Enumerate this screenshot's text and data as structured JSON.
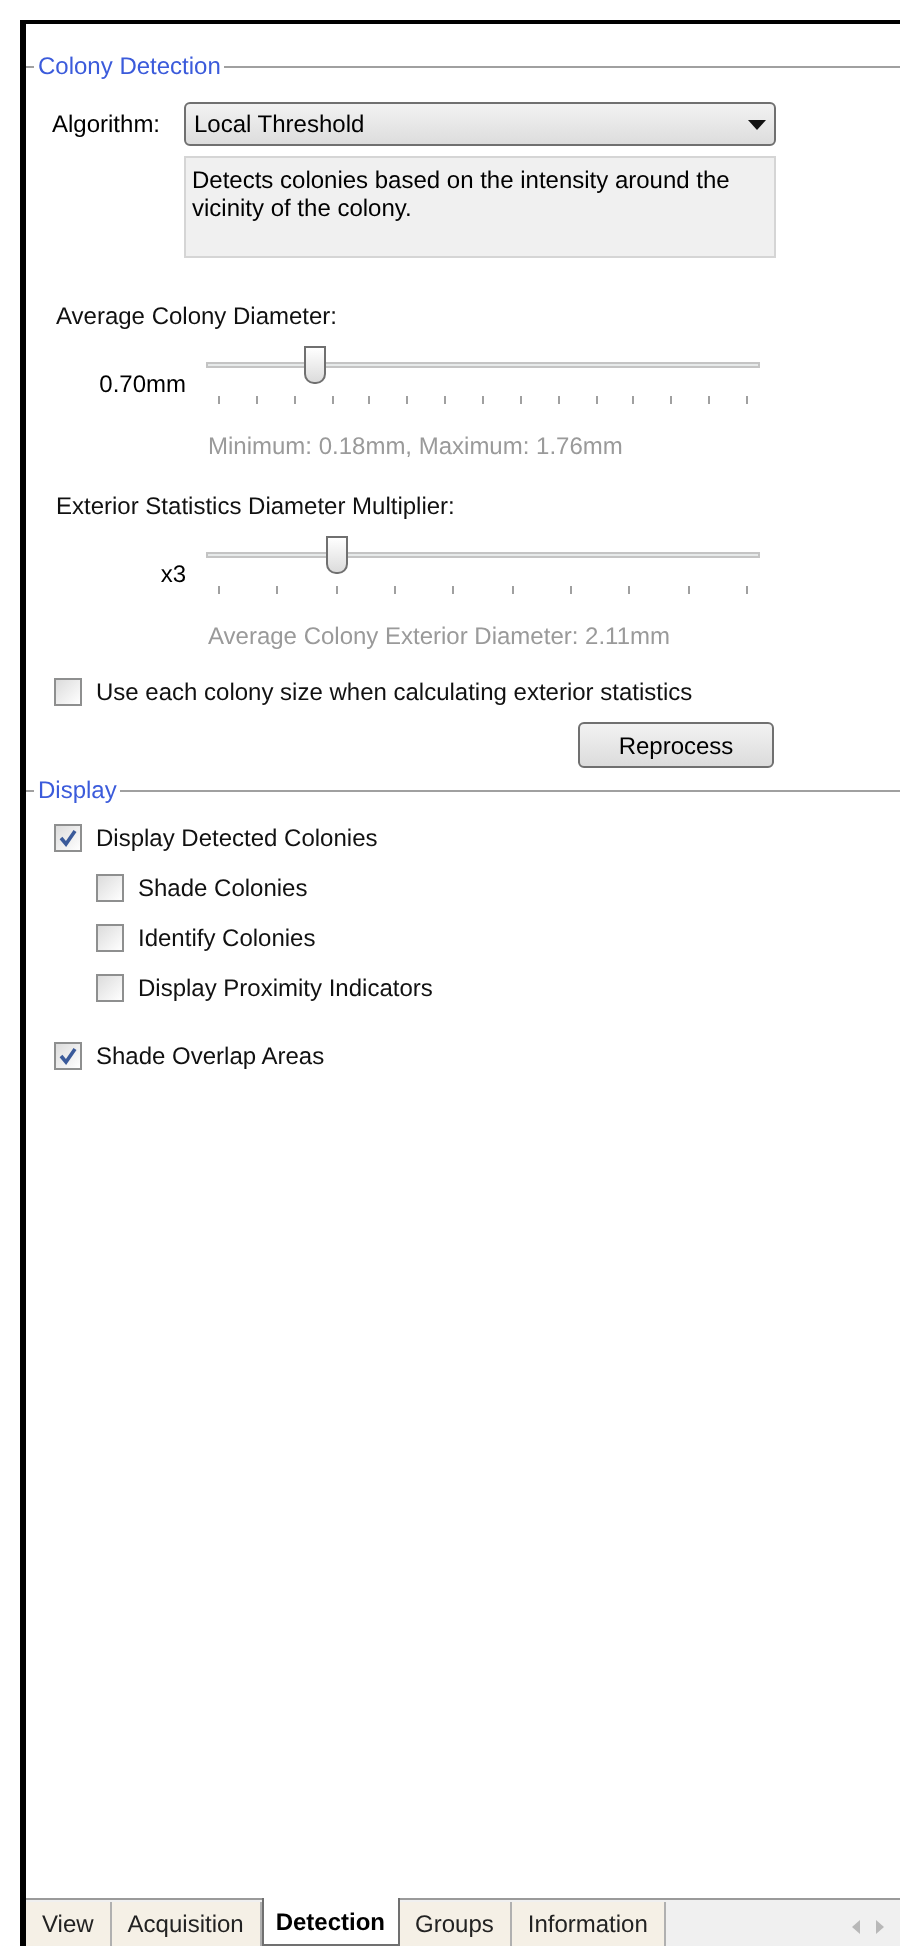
{
  "colony_detection": {
    "title": "Colony Detection",
    "algorithm": {
      "label": "Algorithm:",
      "value": "Local Threshold",
      "description": "Detects colonies based on the intensity around the vicinity of the colony."
    },
    "sliders": [
      {
        "label": "Average Colony Diameter:",
        "reading": "0.70mm",
        "level": 0.18,
        "note": "Minimum: 0.18mm, Maximum: 1.76mm"
      },
      {
        "label": "Exterior Statistics Diameter Multiplier:",
        "reading": "x3",
        "level": 0.222,
        "note": "Average Colony Exterior Diameter: 2.11mm"
      }
    ],
    "use_each_size": {
      "label": "Use each colony size when calculating exterior statistics",
      "checked": false
    },
    "reprocess_button": "Reprocess"
  },
  "display": {
    "title": "Display",
    "options": [
      {
        "label": "Display Detected Colonies",
        "checked": true,
        "children": [
          {
            "label": "Shade Colonies",
            "checked": false
          },
          {
            "label": "Identify Colonies",
            "checked": false
          },
          {
            "label": "Display Proximity Indicators",
            "checked": false
          }
        ]
      },
      {
        "label": "Shade Overlap Areas",
        "checked": true
      }
    ]
  },
  "tabs": [
    {
      "label": "View",
      "selected": false
    },
    {
      "label": "Acquisition",
      "selected": false
    },
    {
      "label": "Detection",
      "selected": true
    },
    {
      "label": "Groups",
      "selected": false
    },
    {
      "label": "Information",
      "selected": false
    }
  ]
}
